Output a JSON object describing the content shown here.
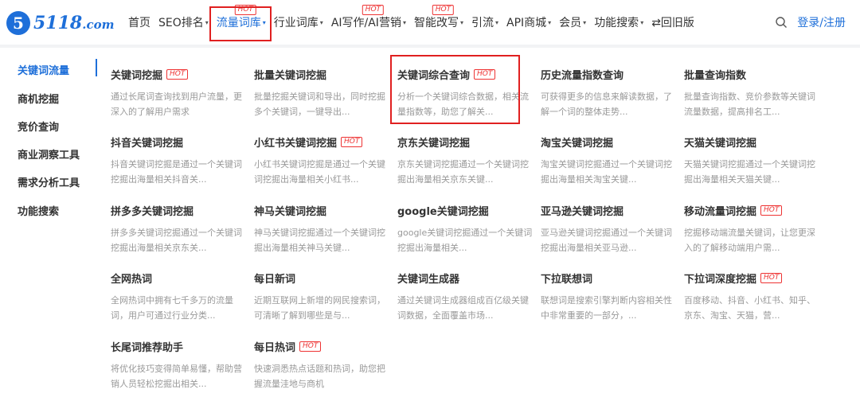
{
  "logo": {
    "mark": "5",
    "text": "5118",
    "suffix": ".com"
  },
  "nav": {
    "items": [
      {
        "label": "首页",
        "caret": false,
        "hot": false
      },
      {
        "label": "SEO排名",
        "caret": true,
        "hot": false
      },
      {
        "label": "流量词库",
        "caret": true,
        "hot": true,
        "active": true
      },
      {
        "label": "行业词库",
        "caret": true,
        "hot": false
      },
      {
        "label": "AI写作/AI营销",
        "caret": true,
        "hot": true
      },
      {
        "label": "智能改写",
        "caret": true,
        "hot": true
      },
      {
        "label": "引流",
        "caret": true,
        "hot": false
      },
      {
        "label": "API商城",
        "caret": true,
        "hot": false
      },
      {
        "label": "会员",
        "caret": true,
        "hot": false
      },
      {
        "label": "功能搜索",
        "caret": true,
        "hot": false
      },
      {
        "label": "⇄回旧版",
        "caret": false,
        "hot": false
      }
    ],
    "hot_label": "HOT",
    "caret": "▾",
    "login": "登录/注册"
  },
  "sidebar": {
    "items": [
      "关键词流量",
      "商机挖掘",
      "竞价查询",
      "商业洞察工具",
      "需求分析工具",
      "功能搜索"
    ]
  },
  "cards": [
    {
      "title": "关键词挖掘",
      "hot": true,
      "desc": "通过长尾词查询找到用户流量，更深入的了解用户需求"
    },
    {
      "title": "批量关键词挖掘",
      "hot": false,
      "desc": "批量挖掘关键词和导出，同时挖掘多个关键词，一键导出..."
    },
    {
      "title": "关键词综合查询",
      "hot": true,
      "desc": "分析一个关键词综合数据，相关流量指数等，助您了解关..."
    },
    {
      "title": "历史流量指数查询",
      "hot": false,
      "desc": "可获得更多的信息来解读数据，了解一个词的整体走势..."
    },
    {
      "title": "批量查询指数",
      "hot": false,
      "desc": "批量查询指数、竞价参数等关键词流量数据，提高排名工..."
    },
    {
      "title": "抖音关键词挖掘",
      "hot": false,
      "desc": "抖音关键词挖掘是通过一个关键词挖掘出海量相关抖音关..."
    },
    {
      "title": "小红书关键词挖掘",
      "hot": true,
      "desc": "小红书关键词挖掘是通过一个关键词挖掘出海量相关小红书..."
    },
    {
      "title": "京东关键词挖掘",
      "hot": false,
      "desc": "京东关键词挖掘通过一个关键词挖掘出海量相关京东关键..."
    },
    {
      "title": "淘宝关键词挖掘",
      "hot": false,
      "desc": "淘宝关键词挖掘通过一个关键词挖掘出海量相关淘宝关键..."
    },
    {
      "title": "天猫关键词挖掘",
      "hot": false,
      "desc": "天猫关键词挖掘通过一个关键词挖掘出海量相关天猫关键..."
    },
    {
      "title": "拼多多关键词挖掘",
      "hot": false,
      "desc": "拼多多关键词挖掘通过一个关键词挖掘出海量相关京东关..."
    },
    {
      "title": "神马关键词挖掘",
      "hot": false,
      "desc": "神马关键词挖掘通过一个关键词挖掘出海量相关神马关键..."
    },
    {
      "title": "google关键词挖掘",
      "hot": false,
      "desc": "google关键词挖掘通过一个关键词挖掘出海量相关..."
    },
    {
      "title": "亚马逊关键词挖掘",
      "hot": false,
      "desc": "亚马逊关键词挖掘通过一个关键词挖掘出海量相关亚马逊..."
    },
    {
      "title": "移动流量词挖掘",
      "hot": true,
      "desc": "挖掘移动端流量关键词，让您更深入的了解移动端用户需..."
    },
    {
      "title": "全网热词",
      "hot": false,
      "desc": "全网热词中拥有七千多万的流量词，用户可通过行业分类..."
    },
    {
      "title": "每日新词",
      "hot": false,
      "desc": "近期互联网上新增的网民搜索词，可清晰了解到哪些是与..."
    },
    {
      "title": "关键词生成器",
      "hot": false,
      "desc": "通过关键词生成器组成百亿级关键词数据，全面覆盖市场..."
    },
    {
      "title": "下拉联想词",
      "hot": false,
      "desc": "联想词是搜索引擎判断内容相关性中非常重要的一部分，..."
    },
    {
      "title": "下拉词深度挖掘",
      "hot": true,
      "desc": "百度移动、抖音、小红书、知乎、京东、淘宝、天猫，营..."
    },
    {
      "title": "长尾词推荐助手",
      "hot": false,
      "desc": "将优化技巧变得简单易懂，帮助营销人员轻松挖掘出相关..."
    },
    {
      "title": "每日热词",
      "hot": true,
      "desc": "快速洞悉热点话题和热词，助您把握流量洼地与商机"
    }
  ],
  "colors": {
    "accent": "#1e6fd9",
    "hot": "#e33333",
    "highlight": "#e02020"
  }
}
